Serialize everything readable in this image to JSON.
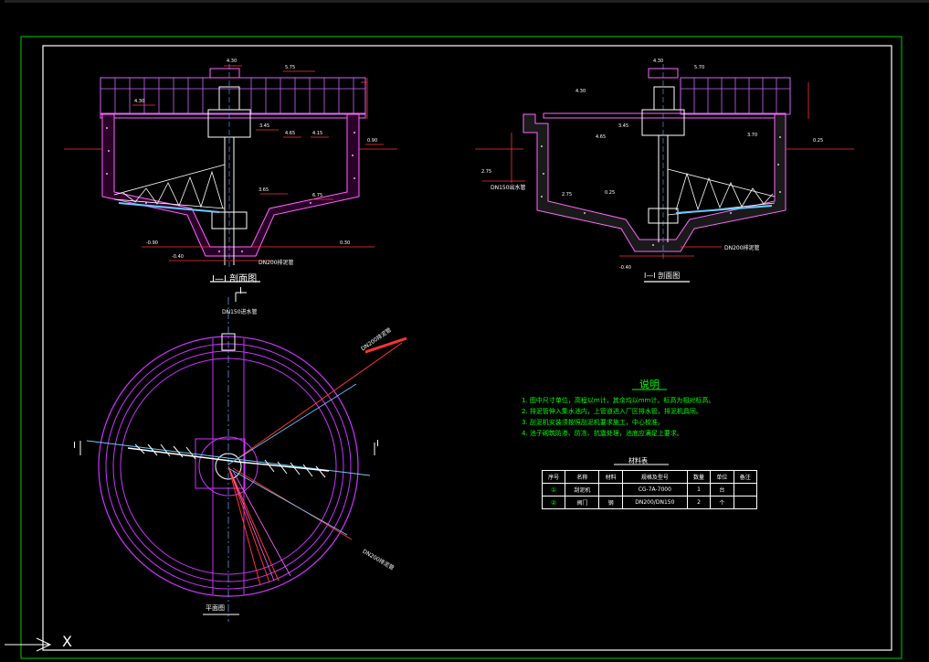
{
  "drawing": {
    "section_title": "I—I 剖面图",
    "section_title_right": "I—I 剖面图",
    "section_mark": "I",
    "plan_title": "平面图",
    "axis_marker": "X"
  },
  "pipes": {
    "outlet_left": "DN200排泥管",
    "outlet_right": "DN200排泥管",
    "inlet_top": "DN150进水管",
    "plan_pipe_1": "DN200排泥管",
    "plan_pipe_2": "DN200排泥管",
    "right_pipe": "DN150出水管"
  },
  "elevations": {
    "e1": "4.30",
    "e2": "5.75",
    "e3": "4.30",
    "e4": "3.45",
    "e5": "4.65",
    "e6": "4.15",
    "e7": "3.65",
    "e8": "2.80",
    "e9": "6.75",
    "e10": "0.90",
    "e11": "0.00",
    "e12": "-0.90",
    "e13": "-0.40",
    "e14": "0.30",
    "e15": "4.90",
    "e16": "2.70",
    "e17": "4.40",
    "e18": "3.65",
    "e19": "-0.20",
    "r1": "4.30",
    "r2": "5.70",
    "r3": "3.45",
    "r4": "4.65",
    "r5": "3.70",
    "r6": "3.60",
    "r7": "2.75",
    "r8": "2.75",
    "r9": "0.25",
    "r10": "-0.40"
  },
  "notes": {
    "title": "说明",
    "items": [
      "1. 图中尺寸单位，高程以m计，其余均以mm计。标高为相对标高。",
      "2. 排泥管伸入集水池内，上管道进入厂区排水管，排泥机具同。",
      "3. 刮泥机安装须按照刮泥机要求施工，中心校准。",
      "4. 池子砌筑防渗、防冻、抗震处理，池底应满足上要求。"
    ]
  },
  "materials": {
    "title": "材料表",
    "headers": [
      "序号",
      "名称",
      "材料",
      "规格及型号",
      "数量",
      "单位",
      "备注"
    ],
    "rows": [
      [
        "①",
        "刮泥机",
        "",
        "CG-7A-7000",
        "1",
        "台",
        ""
      ],
      [
        "②",
        "阀门",
        "钢",
        "DN200/DN150",
        "2",
        "个",
        ""
      ]
    ]
  },
  "colors": {
    "background": "#000000",
    "frame": "#00cc00",
    "structure": "#ff55ff",
    "equipment": "#ffffff",
    "dimension": "#ff3333",
    "centerline": "#66aaff",
    "text": "#ffff00"
  }
}
